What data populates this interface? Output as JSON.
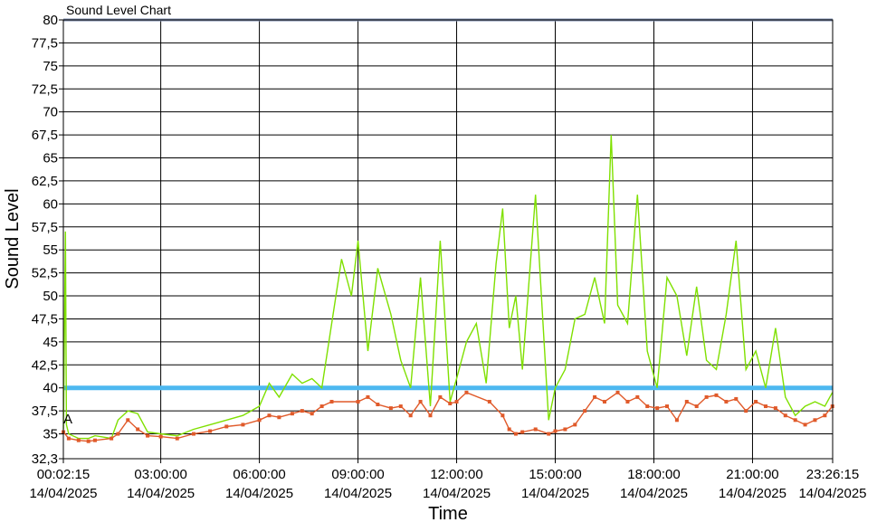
{
  "chart_data": {
    "type": "line",
    "title": "Sound Level Chart",
    "xlabel": "Time",
    "ylabel": "Sound Level",
    "y_ticks": [
      "80",
      "77,5",
      "75",
      "72,5",
      "70",
      "67,5",
      "65",
      "62,5",
      "60",
      "57,5",
      "55",
      "52,5",
      "50",
      "47,5",
      "45",
      "42,5",
      "40",
      "37,5",
      "35",
      "32,3"
    ],
    "y_tick_values": [
      80,
      77.5,
      75,
      72.5,
      70,
      67.5,
      65,
      62.5,
      60,
      57.5,
      55,
      52.5,
      50,
      47.5,
      45,
      42.5,
      40,
      37.5,
      35,
      32.3
    ],
    "ylim": [
      32.3,
      80
    ],
    "x_range_hours": [
      0.0375,
      23.4375
    ],
    "x_ticks": [
      {
        "hour": 0.0375,
        "time": "00:02:15",
        "date": "14/04/2025"
      },
      {
        "hour": 3,
        "time": "03:00:00",
        "date": "14/04/2025"
      },
      {
        "hour": 6,
        "time": "06:00:00",
        "date": "14/04/2025"
      },
      {
        "hour": 9,
        "time": "09:00:00",
        "date": "14/04/2025"
      },
      {
        "hour": 12,
        "time": "12:00:00",
        "date": "14/04/2025"
      },
      {
        "hour": 15,
        "time": "15:00:00",
        "date": "14/04/2025"
      },
      {
        "hour": 18,
        "time": "18:00:00",
        "date": "14/04/2025"
      },
      {
        "hour": 21,
        "time": "21:00:00",
        "date": "14/04/2025"
      },
      {
        "hour": 23.4375,
        "time": "23:26:15",
        "date": "14/04/2025"
      }
    ],
    "threshold": {
      "value": 40,
      "color": "#4db8f0"
    },
    "top_line": {
      "value": 80,
      "color": "#7f8fb0"
    },
    "annotation": "A",
    "grid": true,
    "series": [
      {
        "color": "#7fe000",
        "x_hours": [
          0.04,
          0.1,
          0.13,
          0.2,
          0.5,
          0.8,
          1.0,
          1.5,
          1.7,
          2.0,
          2.3,
          2.6,
          3.0,
          3.5,
          4.0,
          4.5,
          5.0,
          5.5,
          6.0,
          6.3,
          6.6,
          7.0,
          7.3,
          7.6,
          7.9,
          8.2,
          8.5,
          8.8,
          9.0,
          9.3,
          9.6,
          10.0,
          10.3,
          10.6,
          10.9,
          11.2,
          11.5,
          11.8,
          12.0,
          12.3,
          12.6,
          12.9,
          13.2,
          13.4,
          13.6,
          13.8,
          14.0,
          14.4,
          14.8,
          15.0,
          15.3,
          15.6,
          15.9,
          16.2,
          16.5,
          16.7,
          16.9,
          17.2,
          17.5,
          17.8,
          18.1,
          18.4,
          18.7,
          19.0,
          19.3,
          19.6,
          19.9,
          20.2,
          20.5,
          20.8,
          21.1,
          21.4,
          21.7,
          22.0,
          22.3,
          22.6,
          22.9,
          23.2,
          23.43
        ],
        "values": [
          35.5,
          57,
          36,
          35,
          34.5,
          34.5,
          34.8,
          34.5,
          36.5,
          37.5,
          37.2,
          35.2,
          35,
          34.8,
          35.5,
          36,
          36.5,
          37,
          38,
          40.5,
          39,
          41.5,
          40.5,
          41,
          40,
          47,
          54,
          50,
          56,
          44,
          53,
          48,
          43,
          40,
          52,
          38,
          56,
          38.5,
          41,
          45,
          47,
          40.5,
          53.5,
          59.5,
          46.5,
          50,
          42,
          61,
          36.5,
          40,
          42,
          47.5,
          48,
          52,
          47,
          67.5,
          49,
          47,
          61,
          44,
          40,
          52,
          50,
          43.5,
          51,
          43,
          42,
          48,
          56,
          42,
          44,
          40,
          46.5,
          39,
          37,
          38,
          38.5,
          38,
          39.5
        ]
      },
      {
        "color": "#e05a2a",
        "x_hours": [
          0.04,
          0.2,
          0.5,
          0.8,
          1.0,
          1.5,
          1.7,
          2.0,
          2.3,
          2.6,
          3.0,
          3.5,
          4.0,
          4.5,
          5.0,
          5.5,
          6.0,
          6.3,
          6.6,
          7.0,
          7.3,
          7.6,
          7.9,
          8.2,
          9.0,
          9.3,
          9.6,
          10.0,
          10.3,
          10.6,
          10.9,
          11.2,
          11.5,
          11.8,
          12.0,
          12.3,
          13.0,
          13.4,
          13.6,
          13.8,
          14.0,
          14.4,
          14.8,
          15.0,
          15.3,
          15.6,
          15.9,
          16.2,
          16.5,
          16.9,
          17.2,
          17.5,
          17.8,
          18.1,
          18.4,
          18.7,
          19.0,
          19.3,
          19.6,
          19.9,
          20.2,
          20.5,
          20.8,
          21.1,
          21.4,
          21.7,
          22.0,
          22.3,
          22.6,
          22.9,
          23.2,
          23.43
        ],
        "values": [
          35.2,
          34.5,
          34.3,
          34.2,
          34.3,
          34.5,
          35,
          36.5,
          35.5,
          34.8,
          34.7,
          34.5,
          35,
          35.3,
          35.8,
          36,
          36.5,
          37,
          36.8,
          37.2,
          37.5,
          37.2,
          38,
          38.5,
          38.5,
          39,
          38.2,
          37.8,
          38,
          37,
          38.5,
          37,
          39,
          38.3,
          38.5,
          39.5,
          38.5,
          37,
          35.5,
          35,
          35.2,
          35.5,
          35,
          35.3,
          35.5,
          36,
          37.5,
          39,
          38.5,
          39.5,
          38.5,
          39,
          38,
          37.8,
          38,
          36.5,
          38.5,
          38,
          39,
          39.2,
          38.5,
          38.8,
          37.5,
          38.5,
          38,
          37.8,
          37,
          36.5,
          36,
          36.5,
          37,
          38
        ]
      }
    ]
  }
}
